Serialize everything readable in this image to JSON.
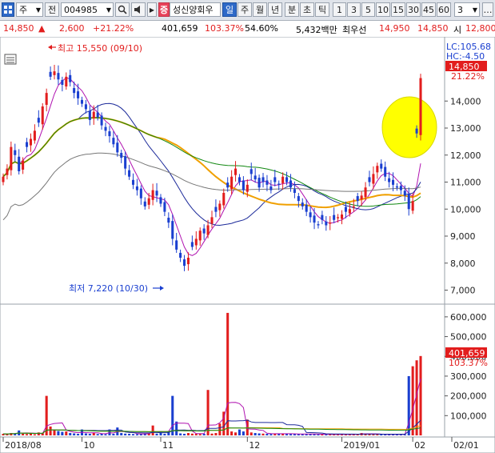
{
  "toolbar": {
    "market_label": "주",
    "prev_label": "전",
    "code_value": "004985",
    "stock_badge": "증",
    "stock_name": "성신양회우",
    "periods": [
      "일",
      "주",
      "월",
      "년",
      "분",
      "초",
      "틱"
    ],
    "active_period": "일",
    "intervals": [
      "1",
      "3",
      "5",
      "10",
      "15",
      "30",
      "45",
      "60"
    ],
    "right_value": "3"
  },
  "info": {
    "price": "14,850",
    "arrow": "▲",
    "change": "2,600",
    "change_pct": "+21.22%",
    "volume": "401,659",
    "volume_ratio": "103.37%",
    "turnover": "54.60%",
    "amount": "5,432백만",
    "best_ask_label": "최우선",
    "best_ask": "14,950",
    "best_bid": "14,850",
    "open_label": "시",
    "open_value": "12,800"
  },
  "price_panel": {
    "lc_label": "LC:105.68",
    "hc_label": "HC:-4.50",
    "current_price_tag": "14,850",
    "current_pct_tag": "21.22%",
    "high_annotation": "최고 15,550 (09/10)",
    "low_annotation": "최저 7,220 (10/30)"
  },
  "volume_panel": {
    "current_volume_tag": "401,659",
    "current_pct_tag": "103.37%"
  },
  "colors": {
    "up": "#e21d1d",
    "down": "#1a3fd0",
    "ma5": "#b012b0",
    "ma20": "#1c2a9a",
    "ma60": "#f0a000",
    "ma120": "#118811",
    "ma240": "#777777",
    "highlight": "#ffff00"
  },
  "chart_data": [
    {
      "type": "candlestick",
      "title": "",
      "ylim": [
        6600,
        16200
      ],
      "y_ticks": [
        "7,000",
        "8,000",
        "9,000",
        "10,000",
        "11,000",
        "12,000",
        "13,000",
        "14,000"
      ],
      "x_ticks": [
        "2018/08",
        "10",
        "11",
        "12",
        "2019/01",
        "02",
        "02/01"
      ],
      "close_series": [
        11200,
        11500,
        12300,
        12000,
        11400,
        11800,
        12300,
        12600,
        12900,
        13200,
        13800,
        14300,
        14900,
        15100,
        14800,
        14600,
        14900,
        14700,
        14300,
        14100,
        13900,
        13700,
        13300,
        13600,
        13400,
        13100,
        12900,
        12700,
        12400,
        12100,
        11900,
        11500,
        11200,
        10900,
        10700,
        10400,
        10100,
        10400,
        10700,
        10500,
        10200,
        9900,
        9500,
        8900,
        8500,
        8200,
        7900,
        8200,
        8600,
        8900,
        9200,
        9100,
        9400,
        9700,
        9900,
        10200,
        10600,
        10800,
        11200,
        11500,
        11000,
        10700,
        10900,
        11300,
        11100,
        10800,
        11000,
        10900,
        10700,
        11000,
        10900,
        11200,
        11000,
        10800,
        10600,
        10300,
        10100,
        9900,
        9700,
        9500,
        9400,
        9600,
        9400,
        9500,
        9600,
        9700,
        9800,
        9900,
        10000,
        10100,
        10300,
        10500,
        10800,
        11000,
        11300,
        11600,
        11500,
        11200,
        11000,
        10900,
        10800,
        10700,
        10500,
        10000,
        10300,
        12800,
        14850
      ]
    },
    {
      "type": "bar",
      "title": "",
      "ylim": [
        0,
        640000
      ],
      "y_ticks": [
        "100,000",
        "200,000",
        "300,000",
        "400,000",
        "500,000",
        "600,000"
      ],
      "values": [
        8000,
        6000,
        12000,
        10000,
        25000,
        8000,
        7000,
        9000,
        6000,
        15000,
        12000,
        200000,
        45000,
        30000,
        22000,
        18000,
        20000,
        12000,
        10000,
        8000,
        30000,
        10000,
        8000,
        12000,
        7000,
        9000,
        6000,
        30000,
        8000,
        40000,
        12000,
        9000,
        8000,
        7000,
        6000,
        8000,
        10000,
        12000,
        50000,
        9000,
        15000,
        8000,
        20000,
        200000,
        70000,
        10000,
        8000,
        12000,
        9000,
        8000,
        7000,
        8000,
        230000,
        9000,
        12000,
        60000,
        120000,
        620000,
        20000,
        15000,
        30000,
        20000,
        80000,
        15000,
        12000,
        10000,
        9000,
        8000,
        7000,
        8000,
        10000,
        9000,
        8000,
        7000,
        6000,
        7000,
        8000,
        6000,
        7000,
        6000,
        5000,
        6000,
        5000,
        6000,
        5000,
        6000,
        5000,
        5000,
        6000,
        5000,
        7000,
        12000,
        10000,
        6000,
        5000,
        6000,
        5000,
        4000,
        5000,
        6000,
        5000,
        6000,
        5000,
        300000,
        350000,
        380000,
        401659
      ]
    }
  ]
}
